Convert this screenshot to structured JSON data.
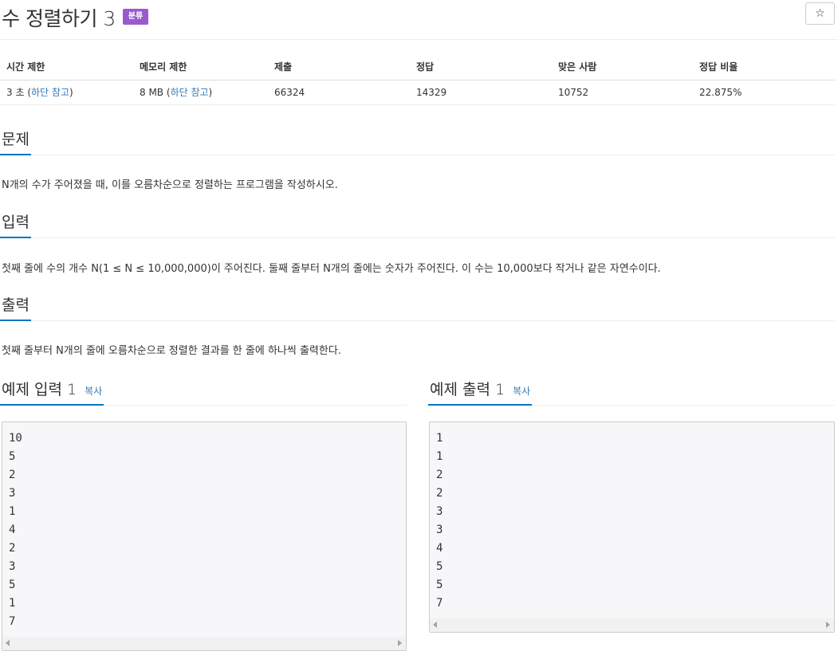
{
  "problem": {
    "title": "수 정렬하기 3",
    "tag_badge": "분류",
    "star_icon": "☆"
  },
  "info": {
    "headers": [
      "시간 제한",
      "메모리 제한",
      "제출",
      "정답",
      "맞은 사람",
      "정답 비율"
    ],
    "time_limit": "3 초",
    "time_link_open": "(",
    "time_link": "하단 참고",
    "time_link_close": ")",
    "memory_limit": "8 MB",
    "memory_link_open": "(",
    "memory_link": "하단 참고",
    "memory_link_close": ")",
    "submissions": "66324",
    "accepted": "14329",
    "solvers": "10752",
    "ratio": "22.875%"
  },
  "sections": {
    "description_title": "문제",
    "description_text": "N개의 수가 주어졌을 때, 이를 오름차순으로 정렬하는 프로그램을 작성하시오.",
    "input_title": "입력",
    "input_text": "첫째 줄에 수의 개수 N(1 ≤ N ≤ 10,000,000)이 주어진다. 둘째 줄부터 N개의 줄에는 숫자가 주어진다. 이 수는 10,000보다 작거나 같은 자연수이다.",
    "output_title": "출력",
    "output_text": "첫째 줄부터 N개의 줄에 오름차순으로 정렬한 결과를 한 줄에 하나씩 출력한다."
  },
  "samples": {
    "input_title": "예제 입력 1",
    "output_title": "예제 출력 1",
    "copy_label": "복사",
    "input_lines": [
      "10",
      "5",
      "2",
      "3",
      "1",
      "4",
      "2",
      "3",
      "5",
      "1",
      "7"
    ],
    "output_lines": [
      "1",
      "1",
      "2",
      "2",
      "3",
      "3",
      "4",
      "5",
      "5",
      "7"
    ]
  },
  "colors": {
    "badge": "#9b59d0",
    "link": "#337ab7",
    "underline": "#0076c0"
  }
}
